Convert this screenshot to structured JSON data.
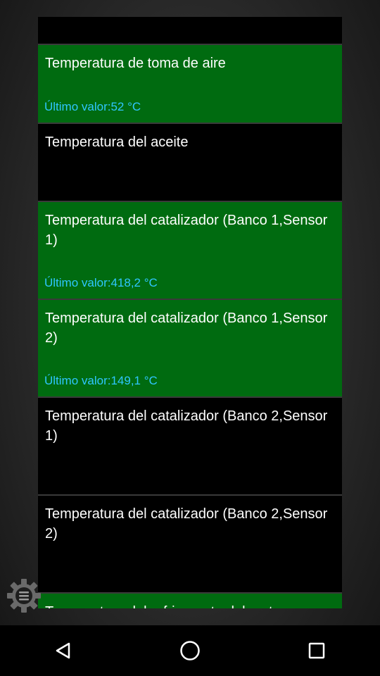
{
  "sensors": [
    {
      "name": "Temperatura de toma de aire",
      "last": "Último valor:52 °C",
      "active": true
    },
    {
      "name": "Temperatura del aceite",
      "last": "",
      "active": false
    },
    {
      "name": "Temperatura del catalizador (Banco 1,Sensor 1)",
      "last": "Último valor:418,2 °C",
      "active": true
    },
    {
      "name": "Temperatura del catalizador (Banco 1,Sensor 2)",
      "last": "Último valor:149,1 °C",
      "active": true
    },
    {
      "name": "Temperatura del catalizador (Banco 2,Sensor 1)",
      "last": "",
      "active": false
    },
    {
      "name": "Temperatura del catalizador (Banco 2,Sensor 2)",
      "last": "",
      "active": false
    },
    {
      "name": "Temperatura del refrigerante del motor",
      "last": "",
      "active": true
    }
  ],
  "icons": {
    "settings": "gear-icon",
    "back": "back-triangle-icon",
    "home": "home-circle-icon",
    "recents": "recents-square-icon"
  },
  "colors": {
    "active_bg": "#006b10",
    "value_text": "#2fc6ff"
  }
}
